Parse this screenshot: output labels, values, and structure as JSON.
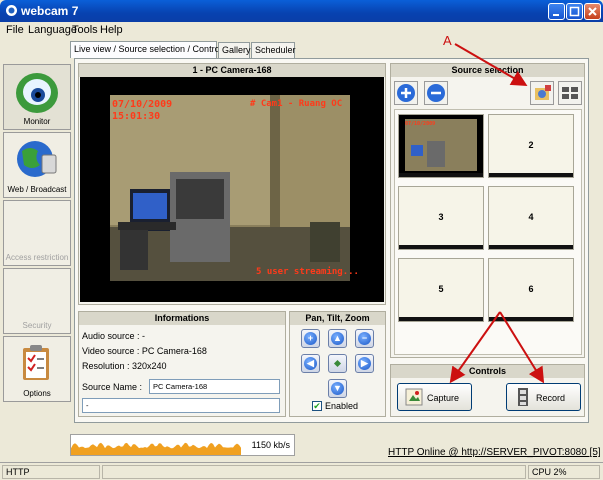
{
  "window": {
    "title": "webcam 7"
  },
  "menu": [
    "File",
    "Language",
    "Tools",
    "Help"
  ],
  "nav": [
    {
      "label": "Monitor",
      "enabled": true
    },
    {
      "label": "Web / Broadcast",
      "enabled": true
    },
    {
      "label": "Access restriction",
      "enabled": false
    },
    {
      "label": "Security",
      "enabled": false
    },
    {
      "label": "Options",
      "enabled": true
    }
  ],
  "tabs": [
    "Live view / Source selection / Controls",
    "Gallery",
    "Scheduler"
  ],
  "video": {
    "panel_title": "1 - PC Camera-168",
    "overlay_date": "07/10/2009",
    "overlay_time": "15:01:30",
    "overlay_cam": "# Cam1 - Ruang OC",
    "overlay_status": "5 user streaming..."
  },
  "info": {
    "title": "Informations",
    "audio_source": "Audio source : -",
    "video_source": "Video source : PC Camera-168",
    "resolution": "Resolution : 320x240",
    "source_name_label": "Source Name :",
    "source_name_value": "PC Camera-168",
    "extra_value": "-"
  },
  "ptz": {
    "title": "Pan, Tilt, Zoom",
    "enabled_label": "Enabled",
    "enabled": true
  },
  "source_selection": {
    "title": "Source selection",
    "slots": [
      "2",
      "3",
      "4",
      "5",
      "6"
    ]
  },
  "controls": {
    "title": "Controls",
    "capture_label": "Capture",
    "record_label": "Record"
  },
  "bandwidth": {
    "rate": "1150 kb/s",
    "level": 0.62
  },
  "http_link": "HTTP Online @ http://SERVER_PIVOT:8080 [5]",
  "status": {
    "http": "HTTP",
    "cpu": "CPU 2%"
  },
  "annotation": {
    "label": "A"
  },
  "colors": {
    "title_bar": "#0842b0",
    "annotation": "#cc1010",
    "overlay_text": "#ff3a1a",
    "bandwidth": "#f0a020"
  }
}
